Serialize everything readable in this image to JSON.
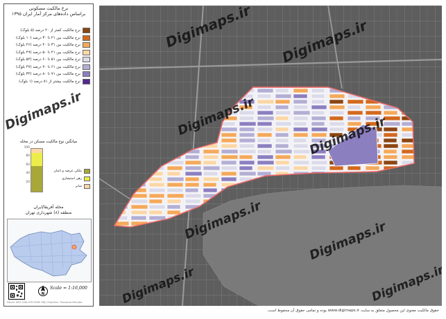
{
  "title": {
    "line1": "نرخ مالکیت مسکونی",
    "line2": "براساس داده‌های مرکز آمار ایران ۱۳۹۵"
  },
  "legend": [
    {
      "label": "نرخ مالکیت کمتر از ۲۰ درصد (۵ بلوک)",
      "color": "#8b4513"
    },
    {
      "label": "نرخ مالکیت بین ۲۱ تا ۳۰ درصد (۱۰ بلوک)",
      "color": "#d2691e"
    },
    {
      "label": "نرخ مالکیت بین ۳۱ تا ۴۰ درصد (۴۶ بلوک)",
      "color": "#f4a95a"
    },
    {
      "label": "نرخ مالکیت بین ۴۱ تا ۵۰ درصد (۴۹ بلوک)",
      "color": "#fbd7a6"
    },
    {
      "label": "نرخ مالکیت بین ۵۱ تا ۶۰ درصد (۵۲ بلوک)",
      "color": "#dcdbea"
    },
    {
      "label": "نرخ مالکیت بین ۶۱ تا ۷۰ درصد (۴۷ بلوک)",
      "color": "#b3aed4"
    },
    {
      "label": "نرخ مالکیت بین ۷۱ تا ۸۰ درصد (۳۲ بلوک)",
      "color": "#8c7fc0"
    },
    {
      "label": "نرخ مالکیت بیشتر از ۸۱ درصد (۱ بلوک)",
      "color": "#54278f"
    }
  ],
  "ownership": {
    "title": "میانگین نوع مالکیت مسکن در محله",
    "ticks": [
      "100",
      "80",
      "60",
      "40",
      "20"
    ],
    "segments": [
      {
        "label": "سایر",
        "color": "#fbd7a6",
        "fraction": 0.1
      },
      {
        "label": "رهن استیجاری",
        "color": "#ecec4a",
        "fraction": 0.3
      },
      {
        "label": "ملکی عرصه و اعیان",
        "color": "#a8a83a",
        "fraction": 0.6
      }
    ]
  },
  "location": {
    "line1": "محله آفریقا/ایران",
    "line2": "منطقه (۸) شهرداری تهران"
  },
  "scale": "Scale = 1:16,000",
  "credit": "Datum: WGS 1984 UTM ZONE 39N | Projection: Transverse Mercator",
  "footer": "حقوق مالکیت معنوی این محصول متعلق به سایت www.digimaps.ir بوده و تمامی حقوق آن محفوظ است.",
  "watermark": "Digimaps.ir",
  "colors": {
    "highlight_boundary": "#e86a6a",
    "lake": "#7a7a7a",
    "base": "#5b5b5b"
  }
}
